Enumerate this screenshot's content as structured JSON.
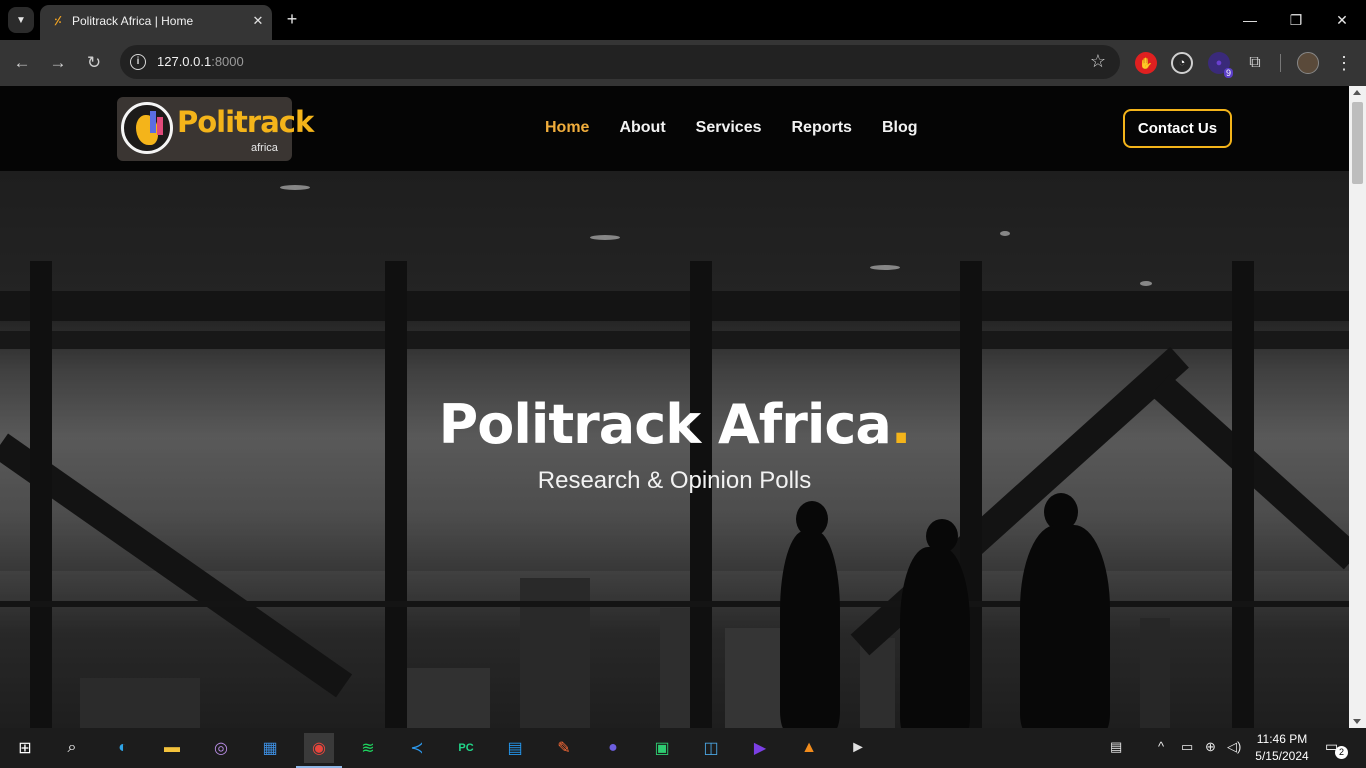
{
  "browser": {
    "tab": {
      "title": "Politrack Africa | Home",
      "close_glyph": "✕"
    },
    "new_tab_glyph": "+",
    "window": {
      "minimize": "—",
      "restore": "❐",
      "close": "✕"
    },
    "nav": {
      "back": "←",
      "forward": "→",
      "reload": "↻"
    },
    "url": {
      "host": "127.0.0.1",
      "port": ":8000"
    },
    "site_info_glyph": "i",
    "bookmark_glyph": "☆",
    "extensions": [
      {
        "name": "adblock-extension-icon",
        "glyph": "✋",
        "color": "#e02020"
      },
      {
        "name": "speed-extension-icon",
        "glyph": "◔",
        "color": "#d0d0d0"
      },
      {
        "name": "extension-badge-icon",
        "glyph": "●",
        "color": "#6a3fd0",
        "badge": "9"
      },
      {
        "name": "extensions-puzzle-icon",
        "glyph": "⧉",
        "color": "#d0d0d0"
      }
    ],
    "menu_glyph": "⋮"
  },
  "site": {
    "logo": {
      "word": "Politrack",
      "sub": "africa"
    },
    "nav": [
      {
        "label": "Home",
        "active": true
      },
      {
        "label": "About",
        "active": false
      },
      {
        "label": "Services",
        "active": false
      },
      {
        "label": "Reports",
        "active": false
      },
      {
        "label": "Blog",
        "active": false
      }
    ],
    "contact_label": "Contact Us",
    "hero": {
      "title": "Politrack Africa",
      "title_dot": ".",
      "subtitle": "Research & Opinion Polls"
    },
    "colors": {
      "accent": "#f4b41a",
      "nav_active": "#f0ad3c",
      "header_bg": "#050505"
    }
  },
  "taskbar": {
    "apps": [
      {
        "name": "start-windows-icon",
        "glyph": "⊞",
        "color": "#ffffff"
      },
      {
        "name": "search-icon",
        "glyph": "⌕",
        "color": "#ffffff"
      },
      {
        "name": "edge-icon",
        "glyph": "◐",
        "color": "#2fa4e7"
      },
      {
        "name": "file-explorer-icon",
        "glyph": "▬",
        "color": "#f3c23c"
      },
      {
        "name": "tor-browser-icon",
        "glyph": "◎",
        "color": "#b58ae0"
      },
      {
        "name": "microsoft-store-icon",
        "glyph": "▦",
        "color": "#3d8ee0"
      },
      {
        "name": "chrome-icon",
        "glyph": "◉",
        "color": "#e8453c",
        "active": true
      },
      {
        "name": "spotify-icon",
        "glyph": "≋",
        "color": "#1ed760"
      },
      {
        "name": "vscode-icon",
        "glyph": "≺",
        "color": "#2d9bf0"
      },
      {
        "name": "pycharm-icon",
        "glyph": "PC",
        "color": "#21d789"
      },
      {
        "name": "docker-icon",
        "glyph": "▤",
        "color": "#2496ed"
      },
      {
        "name": "postman-icon",
        "glyph": "✎",
        "color": "#ff6c37"
      },
      {
        "name": "eclipse-icon",
        "glyph": "●",
        "color": "#6d5fe0"
      },
      {
        "name": "screen-capture-icon",
        "glyph": "▣",
        "color": "#2ecc71"
      },
      {
        "name": "zoom-like-icon",
        "glyph": "◫",
        "color": "#4aa3df"
      },
      {
        "name": "media-app-icon",
        "glyph": "▶",
        "color": "#7b3fe4"
      },
      {
        "name": "vlc-icon",
        "glyph": "▲",
        "color": "#f28c1c"
      },
      {
        "name": "media-player-icon",
        "glyph": "►",
        "color": "#e0e0e0"
      }
    ],
    "tray": {
      "news": "▤",
      "chevron": "^",
      "battery": "▭",
      "network": "⊕",
      "volume": "◁)"
    },
    "time": "11:46 PM",
    "date": "5/15/2024",
    "notification_count": "2"
  }
}
